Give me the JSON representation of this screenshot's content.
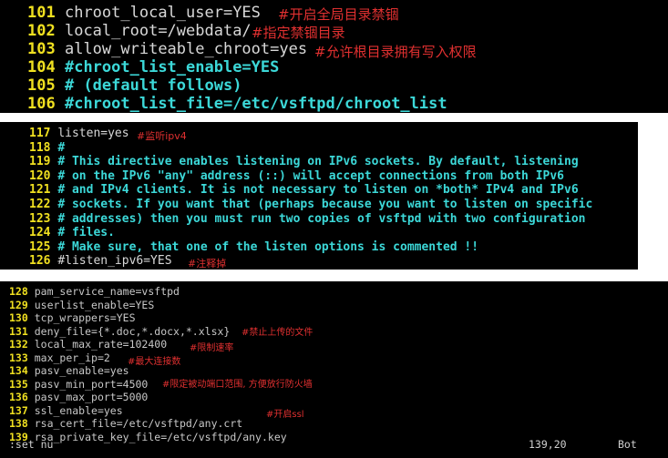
{
  "panel1": {
    "lines": [
      {
        "num": "101",
        "text": "chroot_local_user=YES",
        "kind": "code",
        "note": "#开启全局目录禁锢"
      },
      {
        "num": "102",
        "text": "local_root=/webdata/",
        "kind": "code",
        "note": "#指定禁锢目录"
      },
      {
        "num": "103",
        "text": "allow_writeable_chroot=yes",
        "kind": "code",
        "note": "#允许根目录拥有写入权限"
      },
      {
        "num": "104",
        "text": "#chroot_list_enable=YES",
        "kind": "comment",
        "note": ""
      },
      {
        "num": "105",
        "text": "# (default follows)",
        "kind": "comment",
        "note": ""
      },
      {
        "num": "106",
        "text": "#chroot_list_file=/etc/vsftpd/chroot_list",
        "kind": "comment",
        "note": ""
      }
    ]
  },
  "panel2": {
    "lines": [
      {
        "num": "117",
        "text": "listen=yes",
        "kind": "code",
        "note": "#监听ipv4"
      },
      {
        "num": "118",
        "text": "#",
        "kind": "comment",
        "note": ""
      },
      {
        "num": "119",
        "text": "# This directive enables listening on IPv6 sockets. By default, listening",
        "kind": "comment",
        "note": ""
      },
      {
        "num": "120",
        "text": "# on the IPv6 \"any\" address (::) will accept connections from both IPv6",
        "kind": "comment",
        "note": ""
      },
      {
        "num": "121",
        "text": "# and IPv4 clients. It is not necessary to listen on *both* IPv4 and IPv6",
        "kind": "comment",
        "note": ""
      },
      {
        "num": "122",
        "text": "# sockets. If you want that (perhaps because you want to listen on specific",
        "kind": "comment",
        "note": ""
      },
      {
        "num": "123",
        "text": "# addresses) then you must run two copies of vsftpd with two configuration",
        "kind": "comment",
        "note": ""
      },
      {
        "num": "124",
        "text": "# files.",
        "kind": "comment",
        "note": ""
      },
      {
        "num": "125",
        "text": "# Make sure, that one of the listen options is commented !!",
        "kind": "comment",
        "note": ""
      },
      {
        "num": "126",
        "text": "#listen_ipv6=YES",
        "kind": "code",
        "note": "#注释掉"
      }
    ]
  },
  "panel3": {
    "lines": [
      {
        "num": "128",
        "text": "pam_service_name=vsftpd",
        "kind": "code",
        "note": ""
      },
      {
        "num": "129",
        "text": "userlist_enable=YES",
        "kind": "code",
        "note": ""
      },
      {
        "num": "130",
        "text": "tcp_wrappers=YES",
        "kind": "code",
        "note": ""
      },
      {
        "num": "131",
        "text": "deny_file={*.doc,*.docx,*.xlsx}",
        "kind": "code",
        "note": "#禁止上传的文件"
      },
      {
        "num": "132",
        "text": "local_max_rate=102400",
        "kind": "code",
        "note": "#限制速率"
      },
      {
        "num": "133",
        "text": "max_per_ip=2",
        "kind": "code",
        "note": "#最大连接数"
      },
      {
        "num": "134",
        "text": "pasv_enable=yes",
        "kind": "code",
        "note": ""
      },
      {
        "num": "135",
        "text": "pasv_min_port=4500",
        "kind": "code",
        "note": "#限定被动端口范围, 方便放行防火墙"
      },
      {
        "num": "136",
        "text": "pasv_max_port=5000",
        "kind": "code",
        "note": ""
      },
      {
        "num": "137",
        "text": "ssl_enable=yes",
        "kind": "code",
        "note": "#开启ssl"
      },
      {
        "num": "138",
        "text": "rsa_cert_file=/etc/vsftpd/any.crt",
        "kind": "code",
        "note": ""
      },
      {
        "num": "139",
        "text": "rsa_private_key_file=/etc/vsftpd/any.key",
        "kind": "code",
        "note": ""
      }
    ],
    "status": {
      "command": ":set nu",
      "position": "139,20",
      "scroll": "Bot"
    }
  },
  "colors": {
    "line_number": "#f0e020",
    "comment": "#3cd8d8",
    "annotation": "#e03030",
    "background": "#000000"
  }
}
